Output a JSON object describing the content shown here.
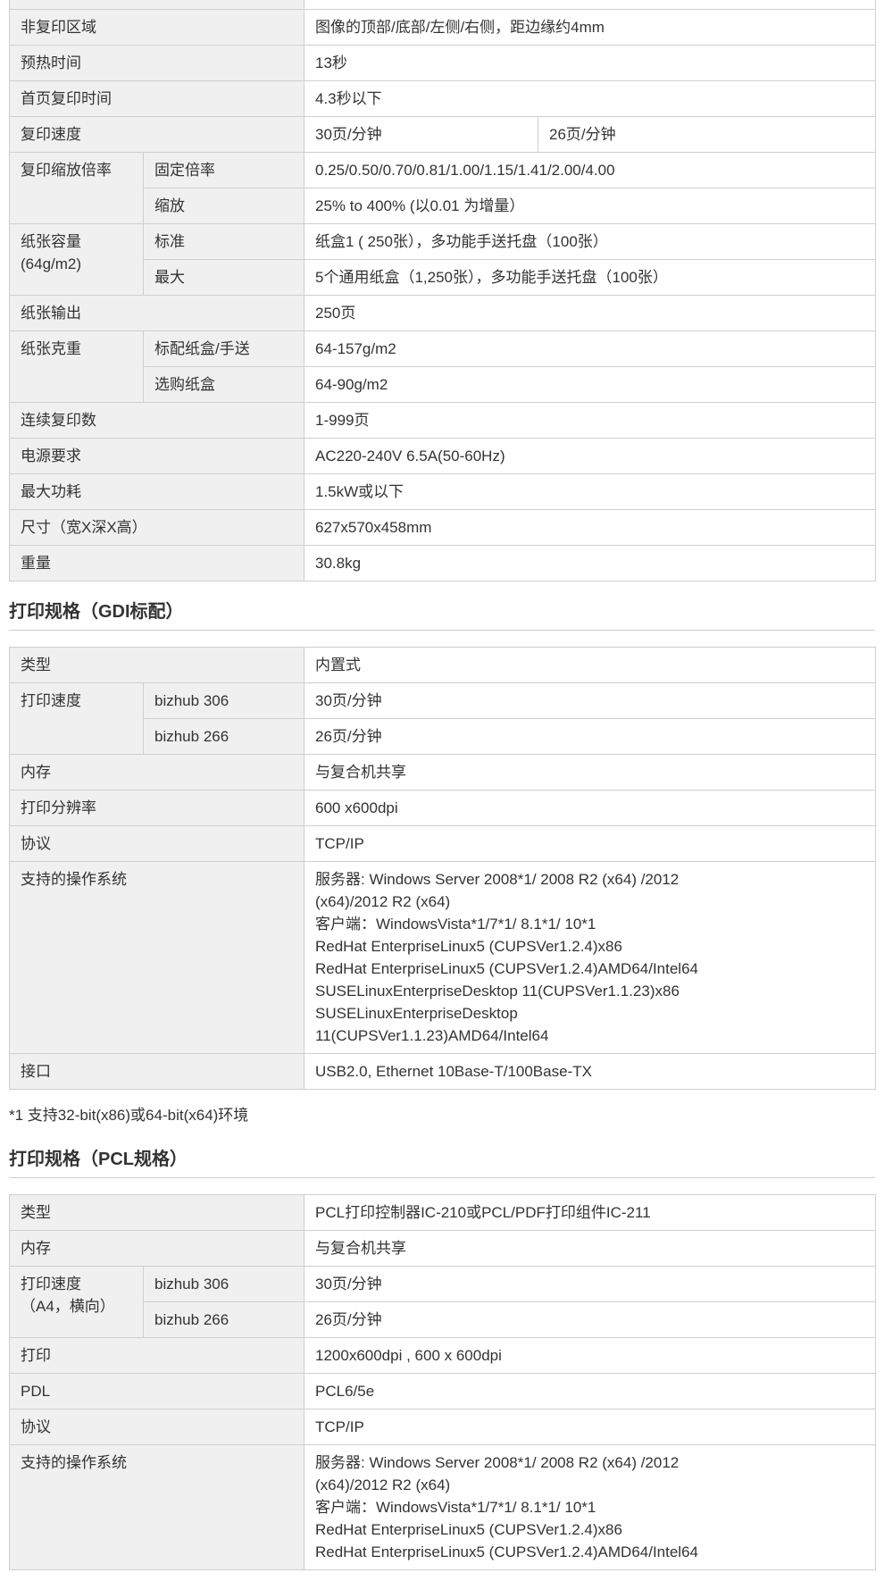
{
  "copy_table": {
    "top_partial": "",
    "rows": [
      {
        "label": "非复印区域",
        "value": "图像的顶部/底部/左侧/右侧，距边缘约4mm"
      },
      {
        "label": "预热时间",
        "value": "13秒"
      },
      {
        "label": "首页复印时间",
        "value": "4.3秒以下"
      },
      {
        "label": "复印速度",
        "value_a": "30页/分钟",
        "value_b": "26页/分钟"
      },
      {
        "label": "复印缩放倍率",
        "sub1": "固定倍率",
        "val1": "0.25/0.50/0.70/0.81/1.00/1.15/1.41/2.00/4.00",
        "sub2": "缩放",
        "val2": "25% to 400% (以0.01 为增量）"
      },
      {
        "label": "纸张容量\n(64g/m2)",
        "sub1": "标准",
        "val1": "纸盒1 ( 250张），多功能手送托盘（100张）",
        "sub2": "最大",
        "val2": "5个通用纸盒（1,250张），多功能手送托盘（100张）"
      },
      {
        "label": "纸张输出",
        "value": "250页"
      },
      {
        "label": "纸张克重",
        "sub1": "标配纸盒/手送",
        "val1": "64-157g/m2",
        "sub2": "选购纸盒",
        "val2": "64-90g/m2"
      },
      {
        "label": "连续复印数",
        "value": "1-999页"
      },
      {
        "label": "电源要求",
        "value": "AC220-240V 6.5A(50-60Hz)"
      },
      {
        "label": "最大功耗",
        "value": "1.5kW或以下"
      },
      {
        "label": "尺寸（宽X深X高）",
        "value": "627x570x458mm"
      },
      {
        "label": "重量",
        "value": "30.8kg"
      }
    ]
  },
  "gdi": {
    "title": "打印规格（GDI标配）",
    "type_label": "类型",
    "type_value": "内置式",
    "speed_label": "打印速度",
    "speed_rows": [
      {
        "model": "bizhub 306",
        "value": "30页/分钟"
      },
      {
        "model": "bizhub 266",
        "value": "26页/分钟"
      }
    ],
    "memory_label": "内存",
    "memory_value": "与复合机共享",
    "res_label": "打印分辨率",
    "res_value": "600 x600dpi",
    "proto_label": "协议",
    "proto_value": "TCP/IP",
    "os_label": "支持的操作系统",
    "os_lines": [
      "服务器: Windows Server 2008*1/ 2008 R2 (x64) /2012",
      "(x64)/2012 R2 (x64)",
      "客户端：WindowsVista*1/7*1/ 8.1*1/ 10*1",
      "RedHat EnterpriseLinux5 (CUPSVer1.2.4)x86",
      "RedHat EnterpriseLinux5 (CUPSVer1.2.4)AMD64/Intel64",
      "SUSELinuxEnterpriseDesktop 11(CUPSVer1.1.23)x86",
      "SUSELinuxEnterpriseDesktop",
      "11(CUPSVer1.1.23)AMD64/Intel64"
    ],
    "iface_label": "接口",
    "iface_value": "USB2.0, Ethernet 10Base-T/100Base-TX",
    "note": "*1 支持32-bit(x86)或64-bit(x64)环境"
  },
  "pcl": {
    "title": "打印规格（PCL规格）",
    "type_label": "类型",
    "type_value": "PCL打印控制器IC-210或PCL/PDF打印组件IC-211",
    "memory_label": "内存",
    "memory_value": "与复合机共享",
    "speed_label": "打印速度\n（A4，横向）",
    "speed_rows": [
      {
        "model": "bizhub 306",
        "value": "30页/分钟"
      },
      {
        "model": "bizhub 266",
        "value": "26页/分钟"
      }
    ],
    "print_label": "打印",
    "print_value": "1200x600dpi , 600 x 600dpi",
    "pdl_label": "PDL",
    "pdl_value": "PCL6/5e",
    "proto_label": "协议",
    "proto_value": "TCP/IP",
    "os_label": "支持的操作系统",
    "os_lines": [
      "服务器: Windows Server 2008*1/ 2008 R2 (x64) /2012",
      "(x64)/2012 R2 (x64)",
      "客户端：WindowsVista*1/7*1/ 8.1*1/ 10*1",
      "RedHat EnterpriseLinux5 (CUPSVer1.2.4)x86",
      "RedHat EnterpriseLinux5 (CUPSVer1.2.4)AMD64/Intel64"
    ]
  }
}
